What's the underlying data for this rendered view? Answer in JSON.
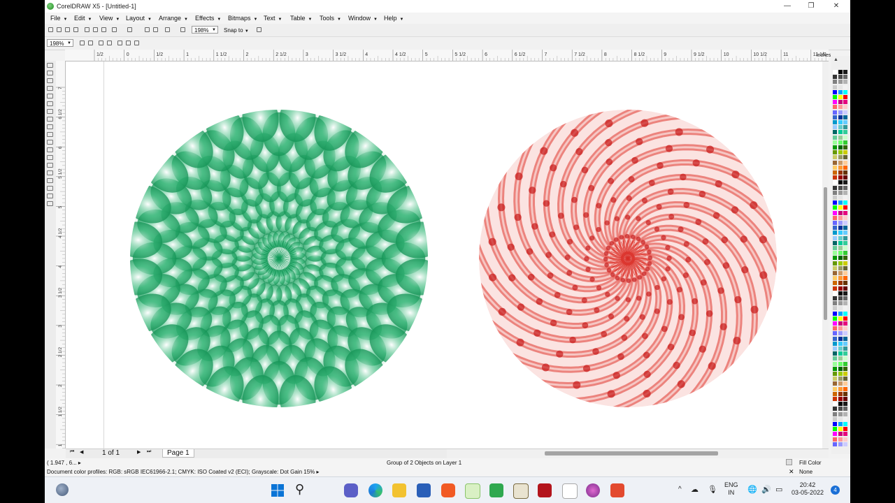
{
  "window": {
    "title": "CorelDRAW X5 - [Untitled-1]",
    "min_glyph": "—",
    "max_glyph": "❐",
    "close_glyph": "✕"
  },
  "menu": [
    {
      "label": "File"
    },
    {
      "label": "Edit"
    },
    {
      "label": "View"
    },
    {
      "label": "Layout"
    },
    {
      "label": "Arrange"
    },
    {
      "label": "Effects"
    },
    {
      "label": "Bitmaps"
    },
    {
      "label": "Text"
    },
    {
      "label": "Table"
    },
    {
      "label": "Tools"
    },
    {
      "label": "Window"
    },
    {
      "label": "Help"
    }
  ],
  "toolbar": {
    "zoom_value": "198%",
    "snap_label": "Snap to"
  },
  "property_bar": {
    "zoom_value": "198%"
  },
  "ruler": {
    "unit": "inches",
    "h_labels": [
      "1/2",
      "0",
      "1/2",
      "1",
      "1 1/2",
      "2",
      "2 1/2",
      "3",
      "3 1/2",
      "4",
      "4 1/2",
      "5",
      "5 1/2",
      "6",
      "6 1/2",
      "7",
      "7 1/2",
      "8",
      "8 1/2",
      "9",
      "9 1/2",
      "10",
      "10 1/2",
      "11",
      "11 1/2"
    ],
    "v_labels": [
      "7",
      "6 1/2",
      "6",
      "5 1/2",
      "5",
      "4 1/2",
      "4",
      "3 1/2",
      "3",
      "2 1/2",
      "2",
      "1 1/2",
      "1"
    ]
  },
  "artwork": {
    "left_colors": {
      "base": "#13a05e",
      "highlight": "#ffffff"
    },
    "right_colors": {
      "base": "#e23b33",
      "highlight": "#ffffff"
    }
  },
  "page_nav": {
    "page_count": "1 of 1",
    "page_tab": "Page 1"
  },
  "status": {
    "coords": "( 1.947 , 6... ▸",
    "selection": "Group of 2 Objects on Layer 1",
    "profiles": "Document color profiles: RGB: sRGB IEC61966-2.1; CMYK: ISO Coated v2 (ECI); Grayscale: Dot Gain 15% ▸",
    "fill": "Fill Color",
    "outline": "None"
  },
  "taskbar": {
    "lang_top": "ENG",
    "lang_bottom": "IN",
    "time": "20:42",
    "date": "03-05-2022",
    "notification_count": "4",
    "tray_chevron": "^"
  },
  "palette_colors": [
    "#ffffff",
    "#000000",
    "#1a1a1a",
    "#333333",
    "#4d4d4d",
    "#666666",
    "#808080",
    "#999999",
    "#b3b3b3",
    "#cccccc",
    "#e6e6e6",
    "#f2f2f2",
    "#0000ff",
    "#00a0ff",
    "#00ffff",
    "#00ff00",
    "#ffff00",
    "#ff0000",
    "#ff00ff",
    "#c8007a",
    "#e6007e",
    "#ff6666",
    "#ff9999",
    "#ffcccc",
    "#6666ff",
    "#9999ff",
    "#ccccff",
    "#3366cc",
    "#003399",
    "#006699",
    "#0099cc",
    "#33ccff",
    "#66ccff",
    "#99ccff",
    "#66cccc",
    "#339999",
    "#006666",
    "#00cc99",
    "#33cc99",
    "#66cc99",
    "#99cc99",
    "#ccffcc",
    "#99ff99",
    "#66ff66",
    "#33cc33",
    "#009900",
    "#006600",
    "#336600",
    "#669900",
    "#99cc00",
    "#cccc00",
    "#cccc66",
    "#999966",
    "#666633",
    "#996633",
    "#cc9966",
    "#ffcc99",
    "#ffcc66",
    "#ff9933",
    "#ff6600",
    "#cc6600",
    "#993300",
    "#663300",
    "#cc3300",
    "#990000",
    "#660000"
  ]
}
